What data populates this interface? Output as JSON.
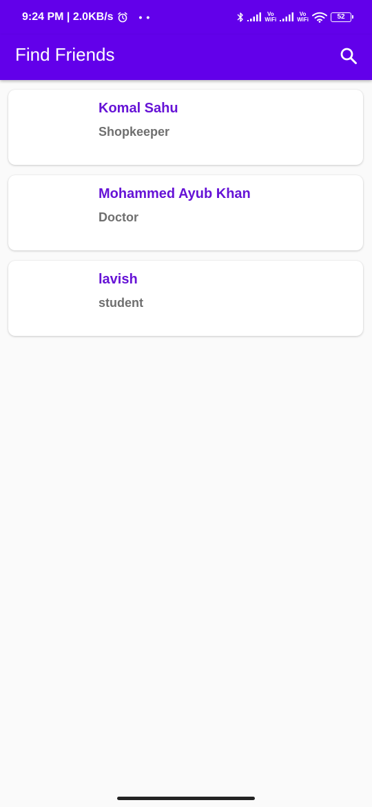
{
  "status_bar": {
    "time": "9:24 PM | 2.0KB/s",
    "dots": "• •",
    "sim1_label_top": "Vo",
    "sim1_label_bottom": "WiFi",
    "sim2_label_top": "Vo",
    "sim2_label_bottom": "WiFi",
    "battery": "52",
    "icons": [
      "alarm-icon",
      "bluetooth-icon",
      "signal-icon",
      "wifi-icon",
      "battery-icon"
    ]
  },
  "app_bar": {
    "title": "Find Friends",
    "search_icon": "search-icon"
  },
  "friends": [
    {
      "name": "Komal Sahu",
      "role": "Shopkeeper"
    },
    {
      "name": "Mohammed Ayub Khan",
      "role": "Doctor"
    },
    {
      "name": "lavish",
      "role": "student"
    }
  ],
  "colors": {
    "primary": "#6200ea",
    "name_text": "#6613d6",
    "role_text": "#6f6f6f",
    "background": "#fafafa"
  }
}
